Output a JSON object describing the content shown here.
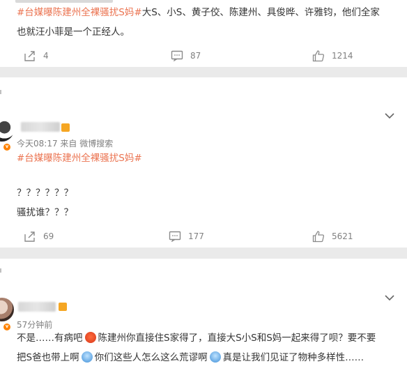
{
  "post1": {
    "hashtag": "#台媒曝陈建州全裸骚扰S妈#",
    "line1_rest": "大S、小S、黄子佼、陈建州、具俊晔、许雅钧，他们全家",
    "line2": "也就汪小菲是一个正经人。",
    "share_count": "4",
    "comment_count": "87",
    "like_count": "1214"
  },
  "post2": {
    "meta": "今天08:17  来自 微博搜索",
    "hashtag": "#台媒曝陈建州全裸骚扰S妈#",
    "line1": "？？？？？？",
    "line2": "骚扰谁？？？",
    "share_count": "69",
    "comment_count": "177",
    "like_count": "5621"
  },
  "post3": {
    "meta": "57分钟前",
    "line1_a": "不是……有病吧",
    "line1_b": "陈建州你直接住S家得了，直接大S小S和S妈一起来得了呗？要不要",
    "line2_a": "把S爸也带上啊",
    "line2_b": "你们这些人怎么这么荒谬啊",
    "line2_c": "真是让我们见证了物种多样性……"
  },
  "colors": {
    "hashtag": "#eb7350",
    "meta": "#808080",
    "badge": "#ff8200"
  },
  "icons": [
    "share-icon",
    "comment-icon",
    "like-icon",
    "chevron-down-icon",
    "verified-badge-icon",
    "angry-emoji-icon",
    "facepalm-emoji-icon"
  ]
}
